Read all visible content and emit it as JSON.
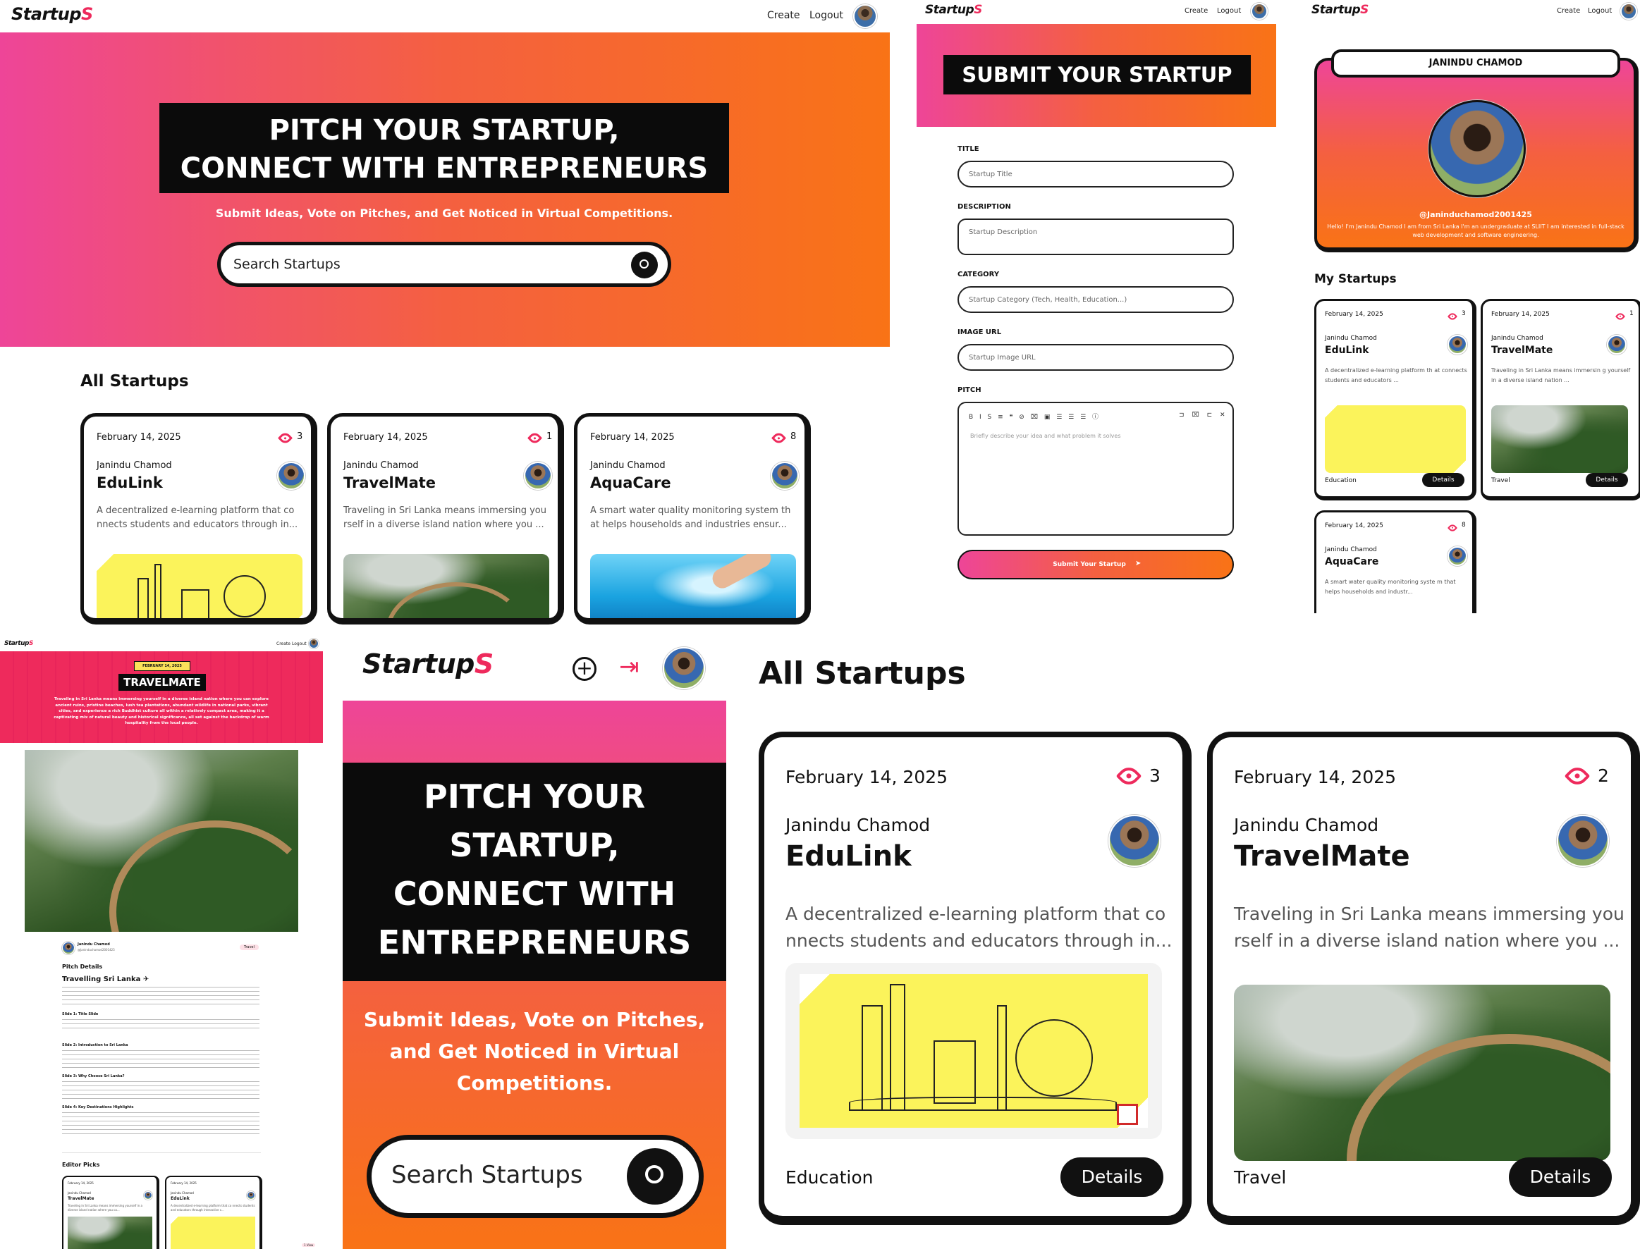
{
  "brand": {
    "logo_text": "Startup",
    "logo_s": "S"
  },
  "nav": {
    "create": "Create",
    "logout": "Logout"
  },
  "hero": {
    "title_line1": "PITCH YOUR STARTUP,",
    "title_line2": "CONNECT WITH ENTREPRENEURS",
    "subtitle": "Submit Ideas, Vote on Pitches, and Get Noticed in Virtual Competitions.",
    "search_placeholder": "Search Startups"
  },
  "section_title": "All Startups",
  "startups": [
    {
      "date": "February 14, 2025",
      "views": "3",
      "author": "Janindu Chamod",
      "title": "EduLink",
      "desc": "A decentralized e-learning platform that co nnects students and educators through in...",
      "category": "Education"
    },
    {
      "date": "February 14, 2025",
      "views": "1",
      "author": "Janindu Chamod",
      "title": "TravelMate",
      "desc": "Traveling in Sri Lanka means immersing you rself in a diverse island nation where you ...",
      "category": "Travel"
    },
    {
      "date": "February 14, 2025",
      "views": "8",
      "author": "Janindu Chamod",
      "title": "AquaCare",
      "desc": "A smart water quality monitoring system th at helps households and industries ensur...",
      "category": ""
    }
  ],
  "submit": {
    "heading": "SUBMIT YOUR STARTUP",
    "title_label": "TITLE",
    "title_placeholder": "Startup Title",
    "desc_label": "DESCRIPTION",
    "desc_placeholder": "Startup Description",
    "cat_label": "CATEGORY",
    "cat_placeholder": "Startup Category (Tech, Health, Education...)",
    "img_label": "IMAGE URL",
    "img_placeholder": "Startup Image URL",
    "pitch_label": "PITCH",
    "pitch_placeholder": "Briefly describe your idea and what problem it solves",
    "submit_button": "Submit Your Startup"
  },
  "profile": {
    "name": "JANINDU CHAMOD",
    "username": "@Janinduchamod2001425",
    "bio": "Hello! I'm Janindu Chamod I am from Sri Lanka I'm an undergraduate at SLIIT I am interested in full-stack web development and software engineering.",
    "my_startups_title": "My Startups",
    "cards": [
      {
        "date": "February 14, 2025",
        "views": "3",
        "author": "Janindu Chamod",
        "title": "EduLink",
        "desc": "A decentralized e-learning platform th at connects students and educators ...",
        "category": "Education",
        "details": "Details"
      },
      {
        "date": "February 14, 2025",
        "views": "1",
        "author": "Janindu Chamod",
        "title": "TravelMate",
        "desc": "Traveling in Sri Lanka means immersin g yourself in a diverse island nation ...",
        "category": "Travel",
        "details": "Details"
      },
      {
        "date": "February 14, 2025",
        "views": "8",
        "author": "Janindu Chamod",
        "title": "AquaCare",
        "desc": "A smart water quality monitoring syste m that helps households and industr...",
        "category": "",
        "details": ""
      }
    ]
  },
  "detail": {
    "date_badge": "FEBRUARY 14, 2025",
    "title": "TRAVELMATE",
    "intro": "Traveling in Sri Lanka means immersing yourself in a diverse island nation where you can explore ancient ruins, pristine beaches, lush tea plantations, abundant wildlife in national parks, vibrant cities, and experience a rich Buddhist culture all within a relatively compact area, making it a captivating mix of natural beauty and historical significance, all set against the backdrop of warm hospitality from the local people.",
    "author": "Janindu Chamod",
    "author_handle": "@Janinduchamod2001425",
    "tag": "Travel",
    "pitch_details": "Pitch Details",
    "pitch_title": "Travelling Sri Lanka ✈",
    "slides": [
      "Slide 1: Title Slide",
      "Slide 2: Introduction to Sri Lanka",
      "Slide 3: Why Choose Sri Lanka?",
      "Slide 4: Key Destinations Highlights"
    ],
    "editor_picks": "Editor Picks",
    "pick_cards": [
      {
        "date": "February 14, 2025",
        "author": "Janindu Chamod",
        "title": "TravelMate",
        "desc": "Traveling in Sri Lanka means immersing yourself in a diverse island nation where you ca..."
      },
      {
        "date": "February 14, 2025",
        "author": "Janindu Chamod",
        "title": "EduLink",
        "desc": "A decentralized e-learning platform that co nnects students and educators through interactive c..."
      }
    ],
    "views_badge": "1 View"
  },
  "mobile": {
    "title_lines": [
      "PITCH YOUR",
      "STARTUP,",
      "CONNECT WITH",
      "ENTREPRENEURS"
    ],
    "subtitle_lines": [
      "Submit Ideas, Vote on Pitches,",
      "and Get Noticed in Virtual",
      "Competitions."
    ],
    "search_placeholder": "Search Startups"
  },
  "zoom": {
    "section_title": "All Startups",
    "cards": [
      {
        "date": "February 14, 2025",
        "views": "3",
        "author": "Janindu Chamod",
        "title": "EduLink",
        "desc_line1": "A decentralized e-learning platform that co",
        "desc_line2": "nnects students and educators through in...",
        "category": "Education",
        "details": "Details"
      },
      {
        "date": "February 14, 2025",
        "views": "2",
        "author": "Janindu Chamod",
        "title": "TravelMate",
        "desc_line1": "Traveling in Sri Lanka means immersing you",
        "desc_line2": "rself in a diverse island nation where you ...",
        "category": "Travel",
        "details": "Details"
      }
    ]
  },
  "colors": {
    "pink": "#ee4598",
    "orange": "#f97316",
    "accent": "#ee2a5c",
    "black": "#0b0b0b"
  }
}
